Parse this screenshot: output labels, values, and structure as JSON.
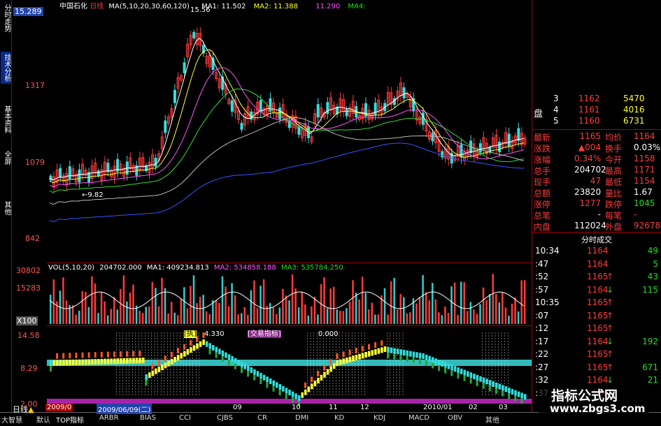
{
  "left_tabs": [
    "分时走势",
    "技术分析",
    "基本资料",
    "全屏",
    "其他"
  ],
  "y_axis": {
    "price_top": "15.289",
    "price_labels": [
      "1317",
      "1079",
      "842"
    ],
    "vol_labels": [
      "30802",
      "15283",
      "X100"
    ],
    "ind_labels": [
      "14.58",
      "8.29",
      "2.00"
    ]
  },
  "main_header": {
    "stock": "中国石化",
    "period": "日线",
    "ma_params": "MA(5,10,20,30,60,120)",
    "ma1": "MA1: 11.502",
    "ma2": "MA2: 11.388",
    "ma3": "11.290",
    "ma4": "MA4:",
    "peak_label": "15.56",
    "low_label": "9.82"
  },
  "vol_header": {
    "params": "VOL(5,10,20)",
    "vol": "204702.000",
    "ma1": "MA1: 409234.813",
    "ma2": "MA2: 534858.188",
    "ma3": "MA3: 535784.250"
  },
  "ind_header": {
    "tag": "[执]",
    "value": "4.330",
    "tag2": "[交易指标]",
    "value2": "0.000"
  },
  "order_book": [
    {
      "n": "3",
      "price": "1162",
      "vol": "5470"
    },
    {
      "n": "4",
      "price": "1161",
      "vol": "4016"
    },
    {
      "n": "5",
      "price": "1160",
      "vol": "6731"
    }
  ],
  "order_book_label": "盘",
  "quote": [
    {
      "l": "最新",
      "v": "1165",
      "l2": "均价",
      "v2": "1164"
    },
    {
      "l": "涨跌",
      "v": "▲004",
      "l2": "换手",
      "v2": "0.03%"
    },
    {
      "l": "涨幅",
      "v": "0.34%",
      "l2": "今开",
      "v2": "1158"
    },
    {
      "l": "总手",
      "v": "204702",
      "l2": "最高",
      "v2": "1171"
    },
    {
      "l": "现手",
      "v": "47",
      "l2": "最低",
      "v2": "1154"
    },
    {
      "l": "总额",
      "v": "23820",
      "l2": "量比",
      "v2": "1.67"
    },
    {
      "l": "涨停",
      "v": "1277",
      "l2": "跌停",
      "v2": "1045"
    },
    {
      "l": "总笔",
      "v": "-",
      "l2": "每笔",
      "v2": "-"
    },
    {
      "l": "内盘",
      "v": "112024",
      "l2": "外盘",
      "v2": "92678"
    }
  ],
  "ticks_title": "分时成交",
  "ticks": [
    {
      "t": "10:34",
      "p": "1164",
      "a": "",
      "v": "49"
    },
    {
      "t": ":47",
      "p": "1164",
      "a": "",
      "v": "5"
    },
    {
      "t": ":52",
      "p": "1165",
      "a": "↑",
      "v": "43"
    },
    {
      "t": ":57",
      "p": "1164",
      "a": "↓",
      "v": "115"
    },
    {
      "t": "10:35",
      "p": "1165",
      "a": "↑",
      "v": ""
    },
    {
      "t": ":07",
      "p": "1165",
      "a": "↑",
      "v": ""
    },
    {
      "t": ":12",
      "p": "1165",
      "a": "↑",
      "v": ""
    },
    {
      "t": ":17",
      "p": "1164",
      "a": "↓",
      "v": "192"
    },
    {
      "t": ":22",
      "p": "1165",
      "a": "↑",
      "v": ""
    },
    {
      "t": ":27",
      "p": "1165",
      "a": "↑",
      "v": "671"
    },
    {
      "t": ":32",
      "p": "1164",
      "a": "↓",
      "v": "21"
    },
    {
      "t": ":37",
      "p": "1164",
      "a": "↓",
      "v": ""
    }
  ],
  "bottom_tabs": [
    "大智慧",
    "默认",
    "TOP指标",
    "ARBR",
    "BIAS",
    "CCI",
    "CJBS",
    "CR",
    "DMI",
    "KD",
    "KDJ",
    "MACD",
    "OBV",
    "其他"
  ],
  "date_labels": [
    "2009/0",
    "2009/06/09(二)",
    "09",
    "10",
    "11",
    "12",
    "2010/01",
    "02",
    "03"
  ],
  "period_indicator": "日线",
  "watermark": {
    "title": "指标公式网",
    "url": "www.zbgs3.com"
  },
  "colors": {
    "up": "#ff3b3b",
    "down": "#22dd22",
    "frame": "#aa0000",
    "accent": "#ffff33"
  }
}
